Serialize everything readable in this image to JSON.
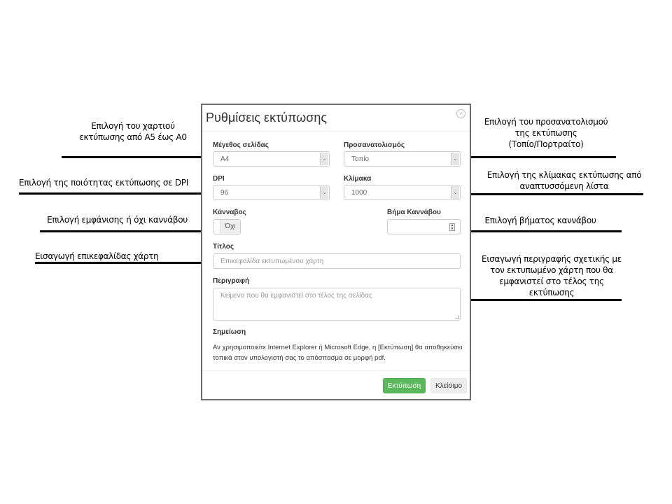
{
  "dialog": {
    "title": "Ρυθμίσεις εκτύπωσης",
    "close_icon": "close-circle-icon",
    "page_size": {
      "label": "Μέγεθος σελίδας",
      "value": "A4"
    },
    "orientation": {
      "label": "Προσανατολισμός",
      "value": "Τοπίο"
    },
    "dpi": {
      "label": "DPI",
      "value": "96"
    },
    "scale": {
      "label": "Κλίμακα",
      "value": "1000"
    },
    "grid": {
      "label": "Κάνναβος",
      "toggle_state": "Όχι"
    },
    "grid_step": {
      "label": "Βήμα Καννάβου",
      "value": ""
    },
    "title_field": {
      "label": "Τίτλος",
      "placeholder": "Επικεφαλίδα εκτυπωμένου χάρτη",
      "value": ""
    },
    "description_field": {
      "label": "Περιγραφή",
      "placeholder": "Κείμενο που θα εμφανιστεί στο τέλος της σελίδας",
      "value": ""
    },
    "note": {
      "label": "Σημείωση",
      "text": "Αν χρησιμοποιείτε Internet Explorer ή Microsoft Edge, η [Εκτύπωση] θα αποθηκεύσει τοπικά στον υπολογιστή σας το απόσπασμα σε μορφή pdf."
    },
    "buttons": {
      "print": "Εκτύπωση",
      "close": "Κλείσιμο"
    },
    "colors": {
      "primary_button": "#5cb85c"
    }
  },
  "annotations": {
    "left": [
      {
        "line1": "Επιλογή του χαρτιού",
        "line2": "εκτύπωσης από Α5 έως Α0"
      },
      {
        "line1": "Επιλογή της ποιότητας εκτύπωσης  σε DPI"
      },
      {
        "line1": "Επιλογή εμφάνισης ή όχι καννάβου"
      },
      {
        "line1": "Εισαγωγή επικεφαλίδας χάρτη"
      }
    ],
    "right": [
      {
        "line1": "Επιλογή του προσανατολισμού",
        "line2": "της εκτύπωσης",
        "line3": "(Τοπίο/Πορτραίτο)"
      },
      {
        "line1": "Επιλογή της κλίμακας εκτύπωσης  από",
        "line2": "αναπτυσσόμενη λίστα"
      },
      {
        "line1": "Επιλογή βήματος καννάβου"
      },
      {
        "line1": "Εισαγωγή περιγραφής σχετικής με",
        "line2": "τον  εκτυπωμένο χάρτη που θα",
        "line3": "εμφανιστεί στο τέλος της",
        "line4": "εκτύπωσης"
      }
    ]
  }
}
